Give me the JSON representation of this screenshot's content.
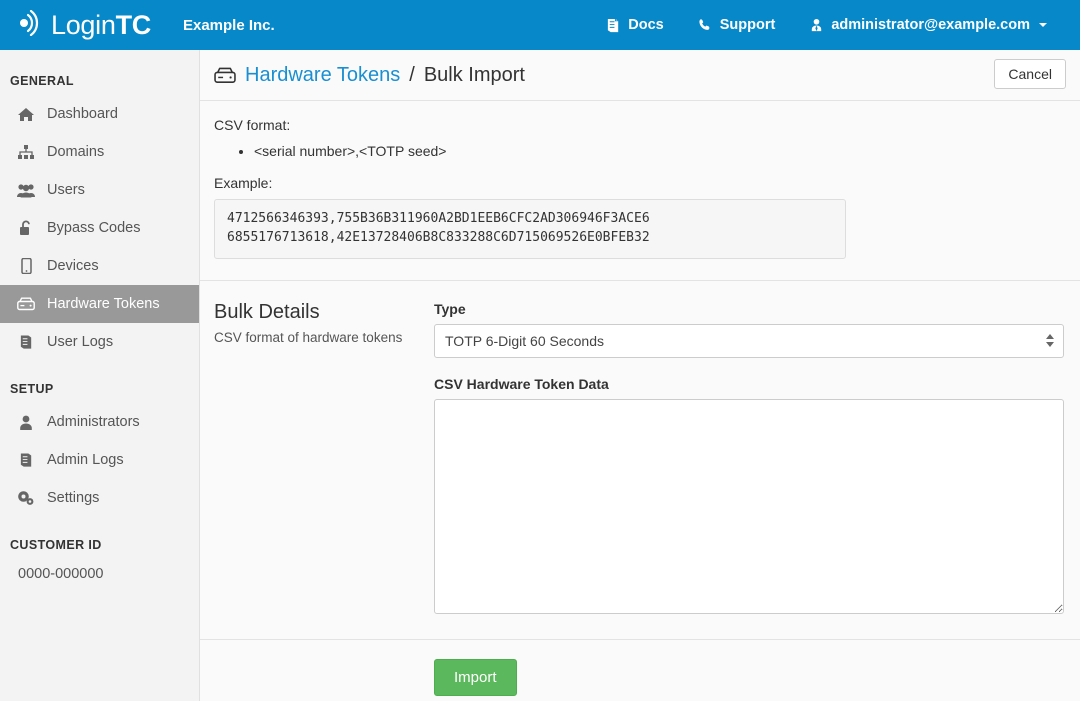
{
  "navbar": {
    "brand_login": "Login",
    "brand_tc": "TC",
    "brand_logo_icon": "signal-wave-icon",
    "org_name": "Example Inc.",
    "links": [
      {
        "label": "Docs",
        "icon": "book-icon"
      },
      {
        "label": "Support",
        "icon": "phone-icon"
      },
      {
        "label": "administrator@example.com",
        "icon": "user-tie-icon"
      }
    ],
    "background_color": "#0788c9"
  },
  "sidebar": {
    "sections": [
      {
        "heading": "GENERAL",
        "items": [
          {
            "label": "Dashboard",
            "icon": "home-icon",
            "active": false
          },
          {
            "label": "Domains",
            "icon": "sitemap-icon",
            "active": false
          },
          {
            "label": "Users",
            "icon": "users-icon",
            "active": false
          },
          {
            "label": "Bypass Codes",
            "icon": "unlock-icon",
            "active": false
          },
          {
            "label": "Devices",
            "icon": "mobile-icon",
            "active": false
          },
          {
            "label": "Hardware Tokens",
            "icon": "hdd-icon",
            "active": true
          },
          {
            "label": "User Logs",
            "icon": "book-icon",
            "active": false
          }
        ]
      },
      {
        "heading": "SETUP",
        "items": [
          {
            "label": "Administrators",
            "icon": "user-icon",
            "active": false
          },
          {
            "label": "Admin Logs",
            "icon": "book-icon",
            "active": false
          },
          {
            "label": "Settings",
            "icon": "gears-icon",
            "active": false
          }
        ]
      }
    ],
    "customer_id_heading": "CUSTOMER ID",
    "customer_id_value": "0000-000000",
    "active_background_color": "#999999"
  },
  "page_header": {
    "breadcrumb_icon": "hdd-icon",
    "breadcrumb_link": "Hardware Tokens",
    "breadcrumb_separator": "/",
    "breadcrumb_current": "Bulk Import",
    "link_color": "#1a8fd1",
    "cancel_label": "Cancel"
  },
  "csv_info": {
    "format_label": "CSV format:",
    "format_items": [
      "<serial number>,<TOTP seed>"
    ],
    "example_label": "Example:",
    "example_lines": [
      "4712566346393,755B36B311960A2BD1EEB6CFC2AD306946F3ACE6",
      "6855176713618,42E13728406B8C833288C6D715069526E0BFEB32"
    ]
  },
  "form": {
    "section_title": "Bulk Details",
    "section_subtitle": "CSV format of hardware tokens",
    "type_label": "Type",
    "type_value": "TOTP 6-Digit 60 Seconds",
    "type_options": [
      "TOTP 6-Digit 60 Seconds"
    ],
    "csv_data_label": "CSV Hardware Token Data",
    "csv_data_value": "",
    "csv_data_placeholder": "",
    "submit_label": "Import",
    "submit_color": "#5cb85c"
  }
}
